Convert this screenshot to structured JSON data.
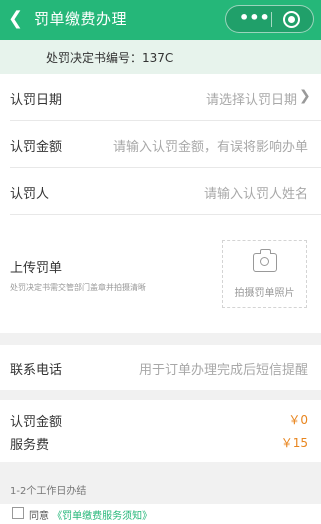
{
  "navbar": {
    "back_icon": "chevron-left-icon",
    "title": "罚单缴费办理",
    "capsule": {
      "more_icon": "more-dots-icon",
      "close_icon": "target-circle-icon"
    },
    "colors": {
      "brand": "#25b779"
    }
  },
  "banner": {
    "text": "处罚决定书编号：137C"
  },
  "form": {
    "date": {
      "label": "认罚日期",
      "placeholder": "请选择认罚日期"
    },
    "amount": {
      "label": "认罚金额",
      "placeholder": "请输入认罚金额，有误将影响办单"
    },
    "person": {
      "label": "认罚人",
      "placeholder": "请输入认罚人姓名"
    },
    "upload": {
      "title": "上传罚单",
      "subtitle": "处罚决定书需交管部门盖章并拍摄清晰",
      "button": "拍摄罚单照片"
    },
    "phone": {
      "label": "联系电话",
      "placeholder": "用于订单办理完成后短信提醒"
    }
  },
  "fees": {
    "fine": {
      "label": "认罚金额",
      "value": "￥0"
    },
    "service": {
      "label": "服务费",
      "value": "￥15"
    },
    "accent_color": "#e8851e"
  },
  "note": "1-2个工作日办结",
  "agreement": {
    "prefix": "同意",
    "link": "《罚单缴费服务须知》"
  }
}
